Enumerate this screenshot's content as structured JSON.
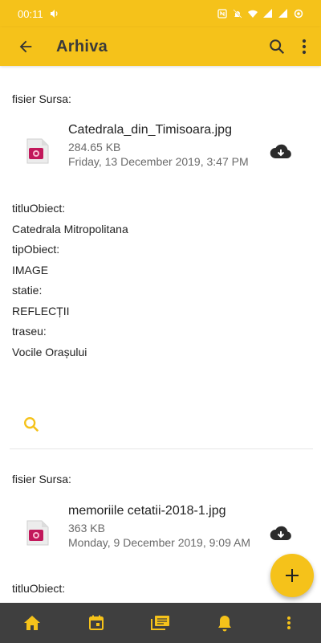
{
  "status_bar": {
    "time": "00:11",
    "icons": [
      "volume-icon",
      "nfc-icon",
      "mute-icon",
      "wifi-icon",
      "signal-icon",
      "signal-icon",
      "data-saver-icon"
    ]
  },
  "app_bar": {
    "title": "Arhiva",
    "icons": [
      "back-arrow-icon",
      "search-icon",
      "more-vert-icon"
    ]
  },
  "records": [
    {
      "source_label": "fisier Sursa:",
      "file": {
        "name": "Catedrala_din_Timisoara.jpg",
        "size": "284.65 KB",
        "date": "Friday, 13 December 2019, 3:47 PM"
      },
      "fields": [
        {
          "label": "titluObiect:",
          "value": "Catedrala Mitropolitana"
        },
        {
          "label": "tipObiect:",
          "value": "IMAGE"
        },
        {
          "label": "statie:",
          "value": "REFLECȚII"
        },
        {
          "label": "traseu:",
          "value": "Vocile Orașului"
        }
      ]
    },
    {
      "source_label": "fisier Sursa:",
      "file": {
        "name": "memoriile cetatii-2018-1.jpg",
        "size": "363 KB",
        "date": "Monday, 9 December 2019, 9:09 AM"
      },
      "fields": [
        {
          "label": "titluObiect:"
        }
      ]
    }
  ],
  "fab": {
    "icon": "plus-icon"
  },
  "bottom_nav": {
    "items": [
      "home-icon",
      "calendar-icon",
      "gallery-icon",
      "bell-icon",
      "more-vert-icon"
    ],
    "active_color": "#f5c21a"
  },
  "colors": {
    "accent": "#f5c21a",
    "nav_bg": "#3f3f3f"
  }
}
